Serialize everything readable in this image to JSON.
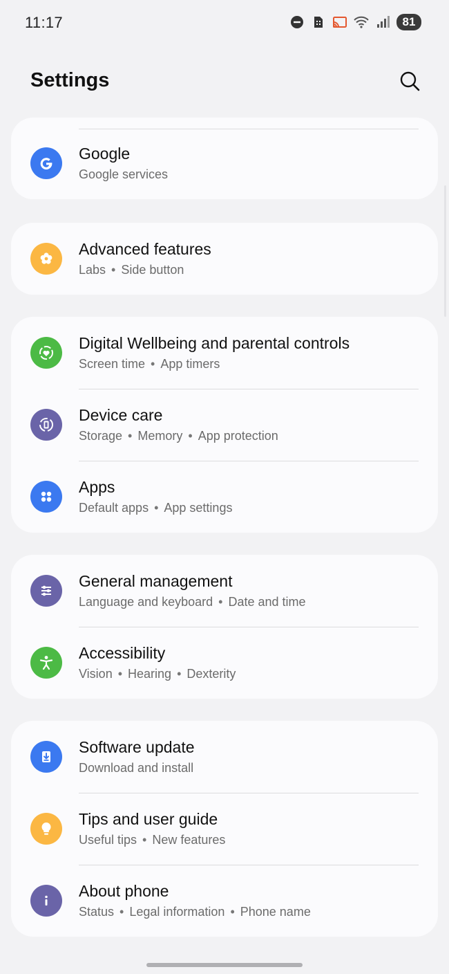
{
  "status_bar": {
    "time": "11:17",
    "icons": [
      "do-not-disturb-icon",
      "sim-icon",
      "cast-icon",
      "wifi-icon",
      "signal-icon"
    ],
    "battery": "81"
  },
  "header": {
    "title": "Settings",
    "search_icon": "search-icon"
  },
  "cards": [
    [
      {
        "key": "google",
        "title": "Google",
        "subtitles": [
          "Google services"
        ],
        "icon": "google-icon",
        "icon_color": "#3b79f0"
      }
    ],
    [
      {
        "key": "advanced-features",
        "title": "Advanced features",
        "subtitles": [
          "Labs",
          "Side button"
        ],
        "icon": "advanced-features-icon",
        "icon_color": "#fbb743"
      }
    ],
    [
      {
        "key": "digital-wellbeing",
        "title": "Digital Wellbeing and parental controls",
        "subtitles": [
          "Screen time",
          "App timers"
        ],
        "icon": "digital-wellbeing-icon",
        "icon_color": "#4cba45"
      },
      {
        "key": "device-care",
        "title": "Device care",
        "subtitles": [
          "Storage",
          "Memory",
          "App protection"
        ],
        "icon": "device-care-icon",
        "icon_color": "#6a64a8"
      },
      {
        "key": "apps",
        "title": "Apps",
        "subtitles": [
          "Default apps",
          "App settings"
        ],
        "icon": "apps-icon",
        "icon_color": "#3b79f0"
      }
    ],
    [
      {
        "key": "general-management",
        "title": "General management",
        "subtitles": [
          "Language and keyboard",
          "Date and time"
        ],
        "icon": "general-management-icon",
        "icon_color": "#6a64a8"
      },
      {
        "key": "accessibility",
        "title": "Accessibility",
        "subtitles": [
          "Vision",
          "Hearing",
          "Dexterity"
        ],
        "icon": "accessibility-icon",
        "icon_color": "#4cba45"
      }
    ],
    [
      {
        "key": "software-update",
        "title": "Software update",
        "subtitles": [
          "Download and install"
        ],
        "icon": "software-update-icon",
        "icon_color": "#3b79f0"
      },
      {
        "key": "tips-user-guide",
        "title": "Tips and user guide",
        "subtitles": [
          "Useful tips",
          "New features"
        ],
        "icon": "lightbulb-icon",
        "icon_color": "#fbb743"
      },
      {
        "key": "about-phone",
        "title": "About phone",
        "subtitles": [
          "Status",
          "Legal information",
          "Phone name"
        ],
        "icon": "info-icon",
        "icon_color": "#6a64a8"
      }
    ]
  ]
}
